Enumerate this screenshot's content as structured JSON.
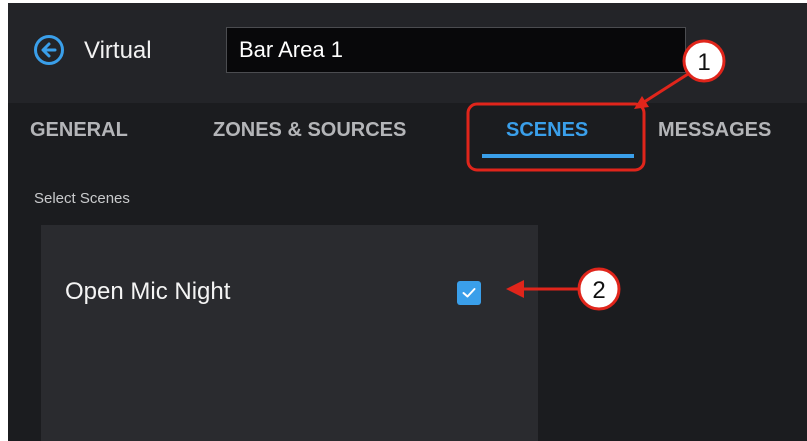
{
  "header": {
    "back_icon": "arrow-left-circle-icon",
    "type_label": "Virtual",
    "name_value": "Bar Area 1"
  },
  "tabs": [
    {
      "label": "GENERAL",
      "active": false
    },
    {
      "label": "ZONES & SOURCES",
      "active": false
    },
    {
      "label": "SCENES",
      "active": true
    },
    {
      "label": "MESSAGES",
      "active": false
    }
  ],
  "scenes": {
    "section_label": "Select Scenes",
    "items": [
      {
        "name": "Open Mic Night",
        "checked": true
      }
    ]
  },
  "callouts": [
    {
      "number": "1",
      "target": "SCENES tab"
    },
    {
      "number": "2",
      "target": "Open Mic Night checkbox"
    }
  ],
  "colors": {
    "accent": "#3a9fea",
    "callout": "#e0251b",
    "background": "#1b1c1f",
    "panel": "#2a2b2f"
  }
}
